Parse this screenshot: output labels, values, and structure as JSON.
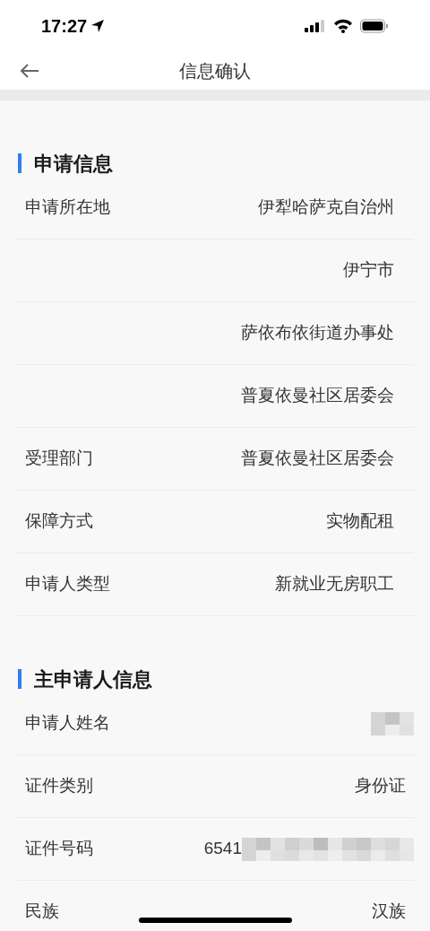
{
  "status_bar": {
    "time": "17:27"
  },
  "nav": {
    "title": "信息确认"
  },
  "sections": [
    {
      "title": "申请信息",
      "rows": [
        {
          "label": "申请所在地",
          "value": "伊犁哈萨克自治州",
          "masked": false
        },
        {
          "label": "",
          "value": "伊宁市",
          "masked": false
        },
        {
          "label": "",
          "value": "萨依布依街道办事处",
          "masked": false
        },
        {
          "label": "",
          "value": "普夏依曼社区居委会",
          "masked": false
        },
        {
          "label": "受理部门",
          "value": "普夏依曼社区居委会",
          "masked": false
        },
        {
          "label": "保障方式",
          "value": "实物配租",
          "masked": false
        },
        {
          "label": "申请人类型",
          "value": "新就业无房职工",
          "masked": false
        }
      ]
    },
    {
      "title": "主申请人信息",
      "rows": [
        {
          "label": "申请人姓名",
          "value": "",
          "masked": true
        },
        {
          "label": "证件类别",
          "value": "身份证",
          "masked": false
        },
        {
          "label": "证件号码",
          "value": "6541",
          "masked": true
        },
        {
          "label": "民族",
          "value": "汉族",
          "masked": false
        }
      ]
    }
  ]
}
